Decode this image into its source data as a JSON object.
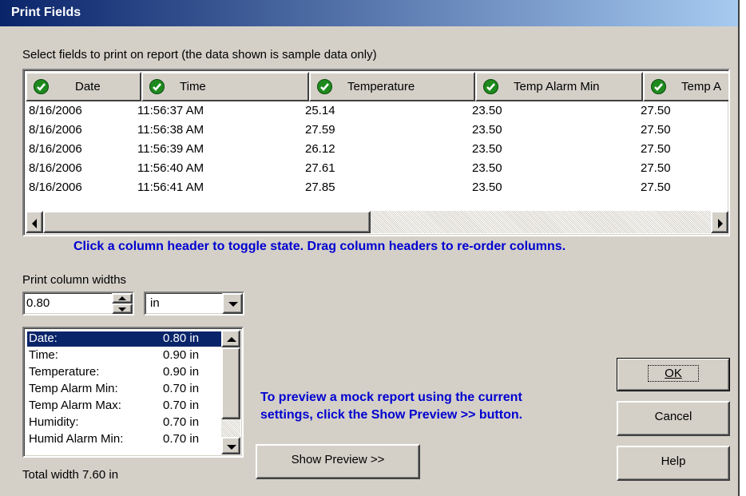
{
  "title": "Print Fields",
  "instructions": "Select fields to print on report (the data shown is sample data only)",
  "columns": [
    "Date",
    "Time",
    "Temperature",
    "Temp Alarm Min",
    "Temp A"
  ],
  "rows": [
    [
      "8/16/2006",
      "11:56:37 AM",
      "25.14",
      "23.50",
      "27.50"
    ],
    [
      "8/16/2006",
      "11:56:38 AM",
      "27.59",
      "23.50",
      "27.50"
    ],
    [
      "8/16/2006",
      "11:56:39 AM",
      "26.12",
      "23.50",
      "27.50"
    ],
    [
      "8/16/2006",
      "11:56:40 AM",
      "27.61",
      "23.50",
      "27.50"
    ],
    [
      "8/16/2006",
      "11:56:41 AM",
      "27.85",
      "23.50",
      "27.50"
    ]
  ],
  "hint": "Click a column header to toggle state. Drag column headers to re-order columns.",
  "width_label": "Print column widths",
  "width_value": "0.80",
  "unit": "in",
  "width_items": [
    {
      "name": "Date:",
      "value": "0.80 in"
    },
    {
      "name": "Time:",
      "value": "0.90 in"
    },
    {
      "name": "Temperature:",
      "value": "0.90 in"
    },
    {
      "name": "Temp Alarm Min:",
      "value": "0.70 in"
    },
    {
      "name": "Temp Alarm Max:",
      "value": "0.70 in"
    },
    {
      "name": "Humidity:",
      "value": "0.70 in"
    },
    {
      "name": "Humid Alarm Min:",
      "value": "0.70 in"
    }
  ],
  "total_width": "Total width 7.60 in",
  "preview_hint_line1": "To preview a mock report using the current",
  "preview_hint_line2": "settings, click the Show Preview >> button.",
  "buttons": {
    "preview": "Show Preview >>",
    "ok": "OK",
    "cancel": "Cancel",
    "help": "Help"
  },
  "colors": {
    "accent": "#0a246a",
    "hint": "#0000d0",
    "check": "#1e8a1e"
  }
}
